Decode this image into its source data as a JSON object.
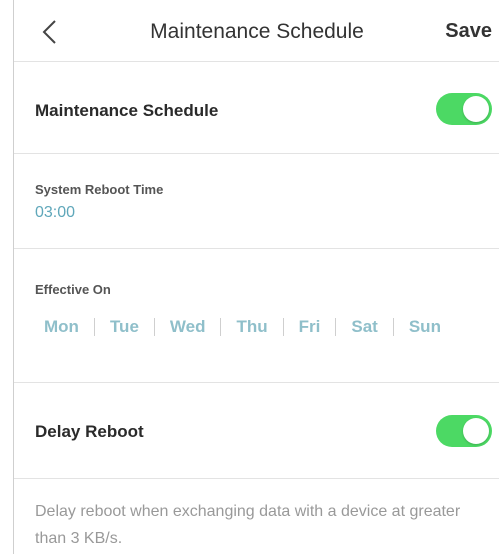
{
  "header": {
    "title": "Maintenance Schedule",
    "save_label": "Save"
  },
  "schedule": {
    "label": "Maintenance Schedule",
    "enabled": true
  },
  "reboot_time": {
    "label": "System Reboot Time",
    "value": "03:00"
  },
  "effective_on": {
    "label": "Effective On",
    "days": [
      "Mon",
      "Tue",
      "Wed",
      "Thu",
      "Fri",
      "Sat",
      "Sun"
    ]
  },
  "delay_reboot": {
    "label": "Delay Reboot",
    "enabled": true,
    "description": "Delay reboot when exchanging data with a device at greater than 3 KB/s."
  },
  "colors": {
    "accent": "#4cd964",
    "link": "#5fa7ba",
    "day": "#8fbfca"
  }
}
